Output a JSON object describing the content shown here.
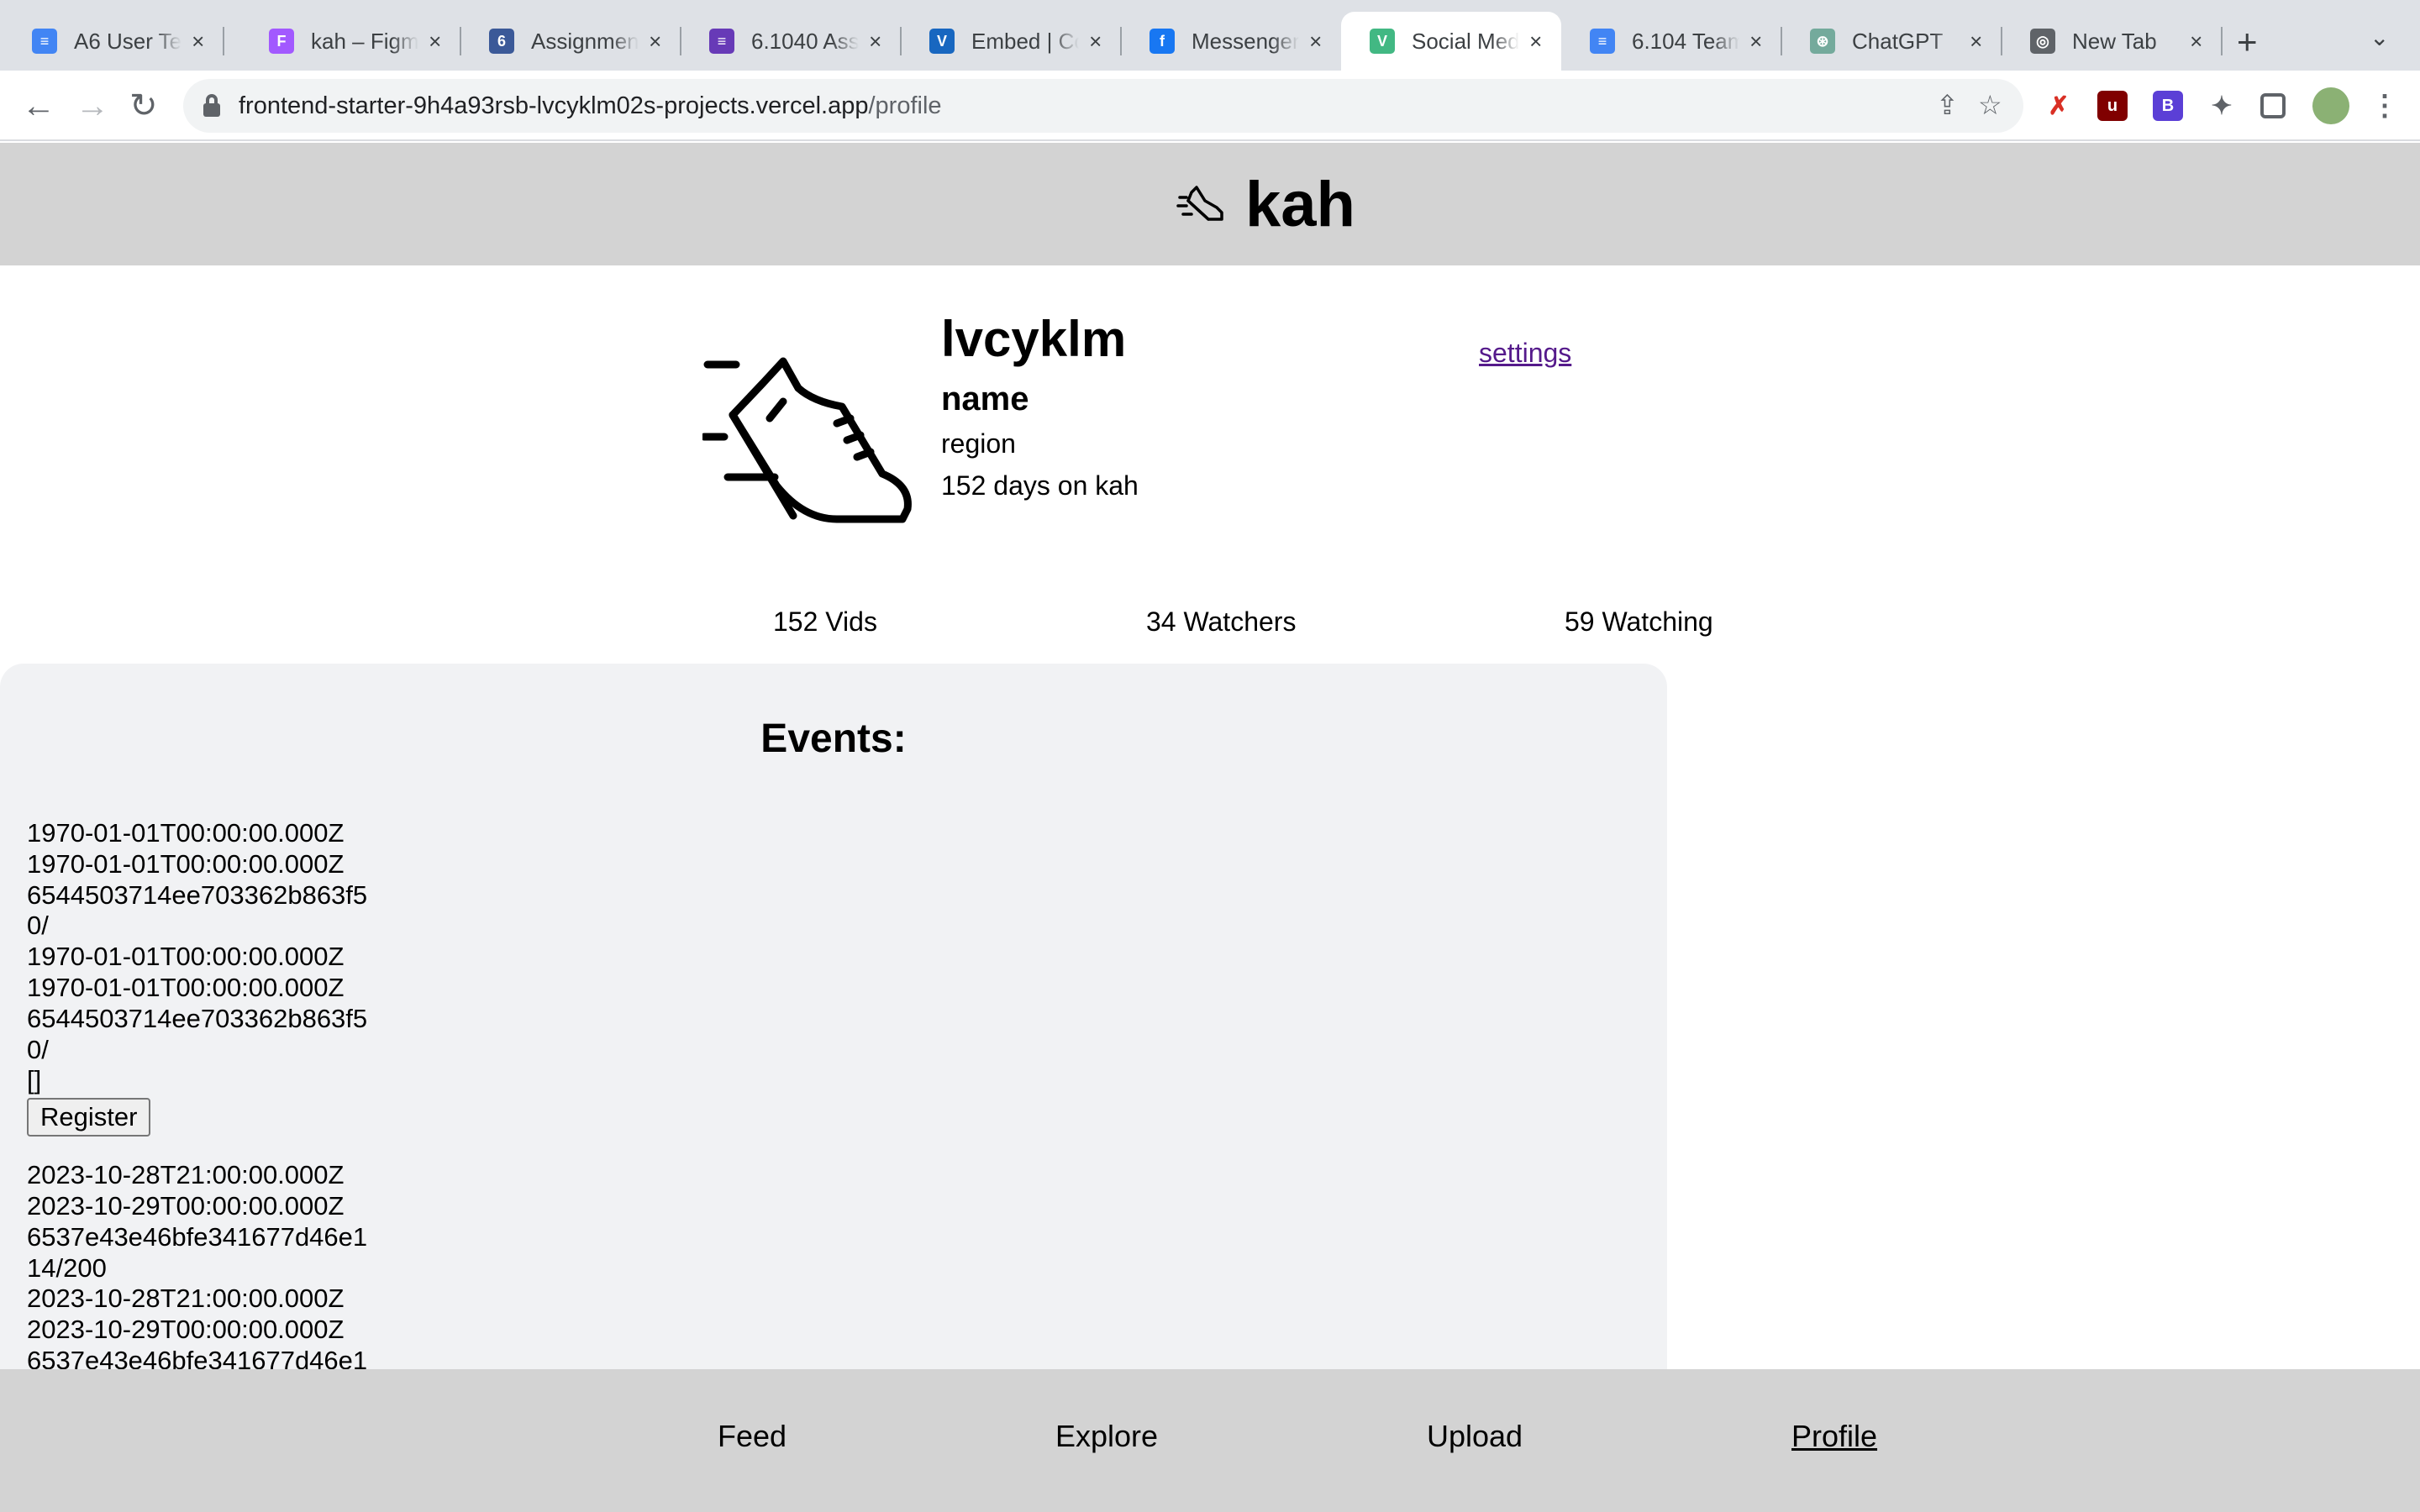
{
  "browser": {
    "tabs": [
      {
        "title": "A6 User Te",
        "icon": "google-docs-icon",
        "color": "#4285f4",
        "glyph": "≡"
      },
      {
        "title": "kah – Figm",
        "icon": "figma-icon",
        "color": "#a259ff",
        "glyph": "F"
      },
      {
        "title": "Assignmen",
        "icon": "course-site-icon",
        "color": "#3b5998",
        "glyph": "6"
      },
      {
        "title": "6.1040 Ass",
        "icon": "google-forms-icon",
        "color": "#673ab7",
        "glyph": "≡"
      },
      {
        "title": "Embed | Co",
        "icon": "vuetify-icon",
        "color": "#1867c0",
        "glyph": "V"
      },
      {
        "title": "Messenger",
        "icon": "facebook-icon",
        "color": "#1877f2",
        "glyph": "f"
      },
      {
        "title": "Social Med",
        "icon": "vue-icon",
        "color": "#42b883",
        "glyph": "V"
      },
      {
        "title": "6.104 Team",
        "icon": "google-docs-icon",
        "color": "#4285f4",
        "glyph": "≡"
      },
      {
        "title": "ChatGPT",
        "icon": "chatgpt-icon",
        "color": "#74aa9c",
        "glyph": "⊛"
      },
      {
        "title": "New Tab",
        "icon": "chrome-icon",
        "color": "#5f6368",
        "glyph": "◎"
      }
    ],
    "active_tab": 6,
    "url_host": "frontend-starter-9h4a93rsb-lvcyklm02s-projects.vercel.app",
    "url_path": "/profile"
  },
  "app": {
    "brand": "kah"
  },
  "profile": {
    "username": "lvcyklm",
    "display_name": "name",
    "region": "region",
    "days": "152 days on kah",
    "settings_label": "settings"
  },
  "stats": {
    "vids": "152 Vids",
    "watchers": "34 Watchers",
    "watching": "59 Watching"
  },
  "events": {
    "title": "Events:",
    "items": [
      {
        "lines": [
          "1970-01-01T00:00:00.000Z",
          "1970-01-01T00:00:00.000Z",
          "6544503714ee703362b863f5",
          "0/",
          "1970-01-01T00:00:00.000Z",
          "1970-01-01T00:00:00.000Z",
          "6544503714ee703362b863f5",
          "0/",
          "[]"
        ],
        "button": "Register"
      },
      {
        "lines": [
          "2023-10-28T21:00:00.000Z",
          "2023-10-29T00:00:00.000Z",
          "6537e43e46bfe341677d46e1",
          "14/200",
          "2023-10-28T21:00:00.000Z",
          "2023-10-29T00:00:00.000Z",
          "6537e43e46bfe341677d46e1"
        ],
        "button": ""
      }
    ]
  },
  "nav": {
    "feed": "Feed",
    "explore": "Explore",
    "upload": "Upload",
    "profile": "Profile"
  }
}
